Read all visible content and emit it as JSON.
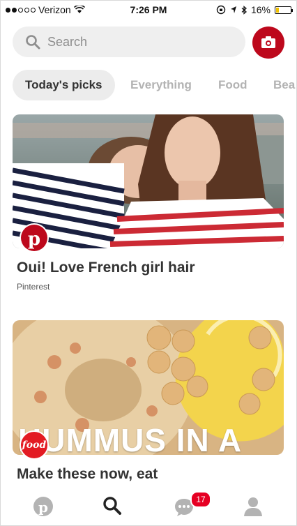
{
  "status_bar": {
    "carrier": "Verizon",
    "time": "7:26 PM",
    "battery": "16%",
    "battery_level": 0.16
  },
  "search": {
    "placeholder": "Search"
  },
  "tabs": [
    {
      "label": "Today's picks",
      "active": true
    },
    {
      "label": "Everything",
      "active": false
    },
    {
      "label": "Food",
      "active": false
    },
    {
      "label": "Bea",
      "active": false
    }
  ],
  "cards": [
    {
      "title": "Oui! Love French girl hair",
      "source": "Pinterest",
      "badge": "pinterest-icon"
    },
    {
      "title": "Make these now, eat",
      "overlay_text": "HUMMUS IN A",
      "badge": "food-network-logo",
      "badge_text": "food"
    }
  ],
  "bottom_nav": {
    "items": [
      "home",
      "search",
      "messages",
      "profile"
    ],
    "notification_count": "17"
  },
  "colors": {
    "brand_red": "#bd081c",
    "badge_red": "#e60023"
  }
}
